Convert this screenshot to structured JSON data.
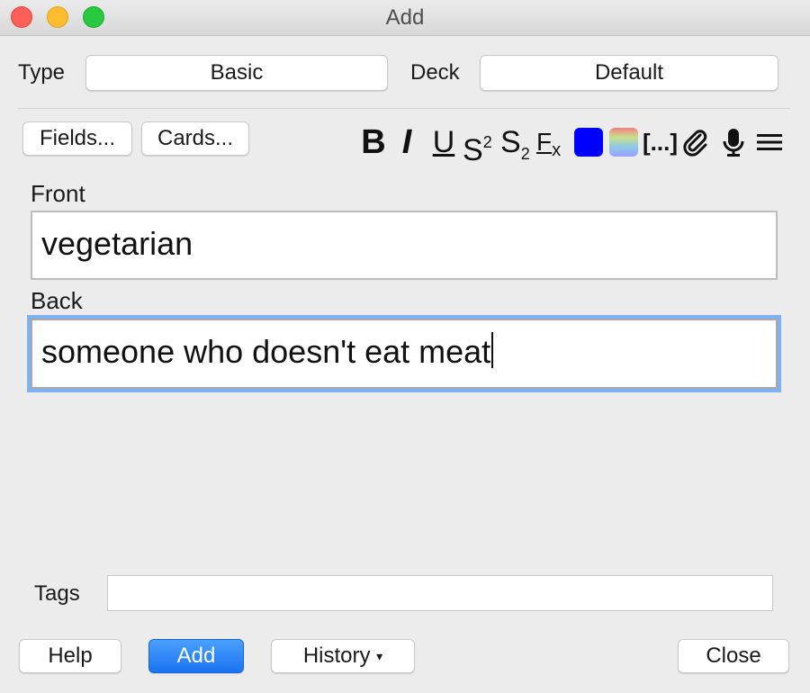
{
  "window": {
    "title": "Add"
  },
  "top_row": {
    "type_label": "Type",
    "type_value": "Basic",
    "deck_label": "Deck",
    "deck_value": "Default"
  },
  "buttons": {
    "fields": "Fields...",
    "cards": "Cards..."
  },
  "toolbar": {
    "bold": "B",
    "italic": "I",
    "underline": "U",
    "superscript_base": "S",
    "superscript_sup": "2",
    "subscript_base": "S",
    "subscript_sub": "2",
    "clear_format_base": "F",
    "clear_format_x": "x",
    "text_color": "#0000ff",
    "cloze": "[...]"
  },
  "fields": [
    {
      "label": "Front",
      "value": "vegetarian"
    },
    {
      "label": "Back",
      "value": "someone who doesn't eat meat"
    }
  ],
  "tags": {
    "label": "Tags",
    "value": ""
  },
  "bottom": {
    "help": "Help",
    "add": "Add",
    "history": "History",
    "history_arrow": "▾",
    "close": "Close"
  }
}
